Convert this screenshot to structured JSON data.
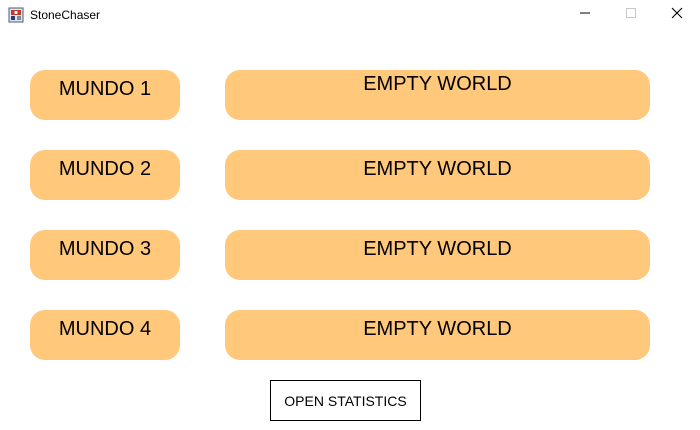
{
  "window": {
    "title": "StoneChaser",
    "icon": "stonechaser-app-icon",
    "controls": {
      "minimize": "minimize-icon",
      "maximize": "maximize-icon",
      "close": "close-icon"
    }
  },
  "worlds": [
    {
      "label": "MUNDO 1",
      "slot_label": "EMPTY WORLD"
    },
    {
      "label": "MUNDO 2",
      "slot_label": "EMPTY WORLD"
    },
    {
      "label": "MUNDO 3",
      "slot_label": "EMPTY WORLD"
    },
    {
      "label": "MUNDO 4",
      "slot_label": "EMPTY WORLD"
    }
  ],
  "statistics_button_label": "OPEN STATISTICS",
  "colors": {
    "button_fill": "#ffc87a",
    "text": "#000000",
    "background": "#ffffff"
  }
}
